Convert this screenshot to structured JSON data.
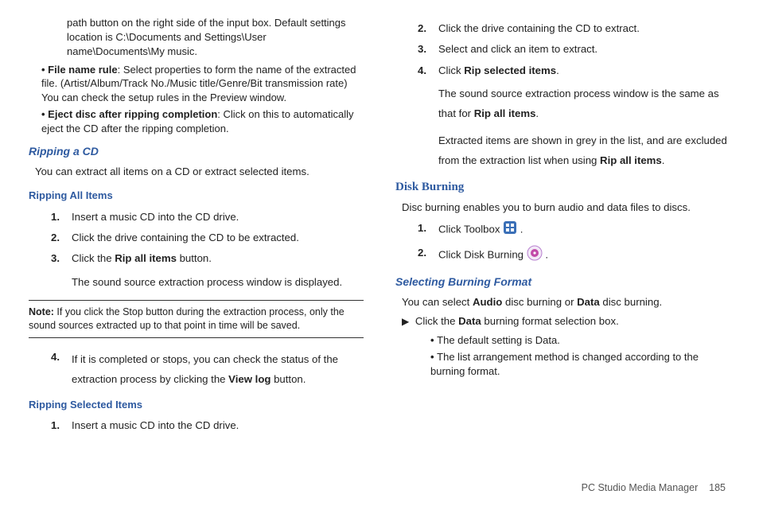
{
  "left": {
    "top_continuation": "path button on the right side of the input box. Default settings location is C:\\Documents and Settings\\User name\\Documents\\My music.",
    "bullets": [
      {
        "label": "File name rule",
        "text": ": Select properties to form the name of the extracted file. (Artist/Album/Track No./Music title/Genre/Bit transmission rate) You can check the setup rules in the Preview window."
      },
      {
        "label": "Eject disc after ripping completion",
        "text": ": Click on this to automatically eject the CD after the ripping completion."
      }
    ],
    "sec_ripping_cd": "Ripping a CD",
    "ripping_cd_body": "You can extract all items on a CD or extract selected items.",
    "sec_ripping_all": "Ripping All Items",
    "steps_all": [
      "Insert a music CD into the CD drive.",
      "Click the drive containing the CD to be extracted."
    ],
    "step3_prefix": "Click the ",
    "step3_bold": "Rip all items",
    "step3_suffix": " button.",
    "step3_after": "The sound source extraction process window is displayed.",
    "note_label": "Note:",
    "note_body": " If you click the Stop button during the extraction process, only the sound sources extracted up to that point in time will be saved.",
    "step4_prefix": "If it is completed or stops, you can check the status of the extraction process by clicking the ",
    "step4_bold": "View log",
    "step4_suffix": " button.",
    "sec_ripping_sel": "Ripping Selected Items",
    "step_sel_1": "Insert a music CD into the CD drive."
  },
  "right": {
    "sel_steps": [
      "Click the drive containing the CD to extract.",
      "Select and click an item to extract."
    ],
    "sel_step4_prefix": "Click ",
    "sel_step4_bold": "Rip selected items",
    "sel_step4_suffix": ".",
    "after_sel_1a": "The sound source extraction process window is the same as that for ",
    "after_sel_1b": "Rip all items",
    "after_sel_1c": ".",
    "after_sel_2a": "Extracted items are shown in grey in the list, and are excluded from the extraction list when using ",
    "after_sel_2b": "Rip all items",
    "after_sel_2c": ".",
    "disk_burning": "Disk Burning",
    "disk_burning_body": "Disc burning enables you to burn audio and data files to discs.",
    "db_step1_prefix": "Click Toolbox ",
    "db_step1_suffix": " .",
    "db_step2_prefix": "Click Disk Burning ",
    "db_step2_suffix": " .",
    "sec_sel_format": "Selecting Burning Format",
    "sel_format_body_pre": "You can select ",
    "sel_format_bold1": "Audio",
    "sel_format_mid": " disc burning or ",
    "sel_format_bold2": "Data",
    "sel_format_end": " disc burning.",
    "tri_prefix": "Click the ",
    "tri_bold": "Data",
    "tri_suffix": " burning format selection box.",
    "sub_bullets": [
      "The default setting is Data.",
      "The list arrangement method is changed according to the burning format."
    ]
  },
  "footer": {
    "title": "PC Studio Media Manager",
    "page": "185"
  }
}
